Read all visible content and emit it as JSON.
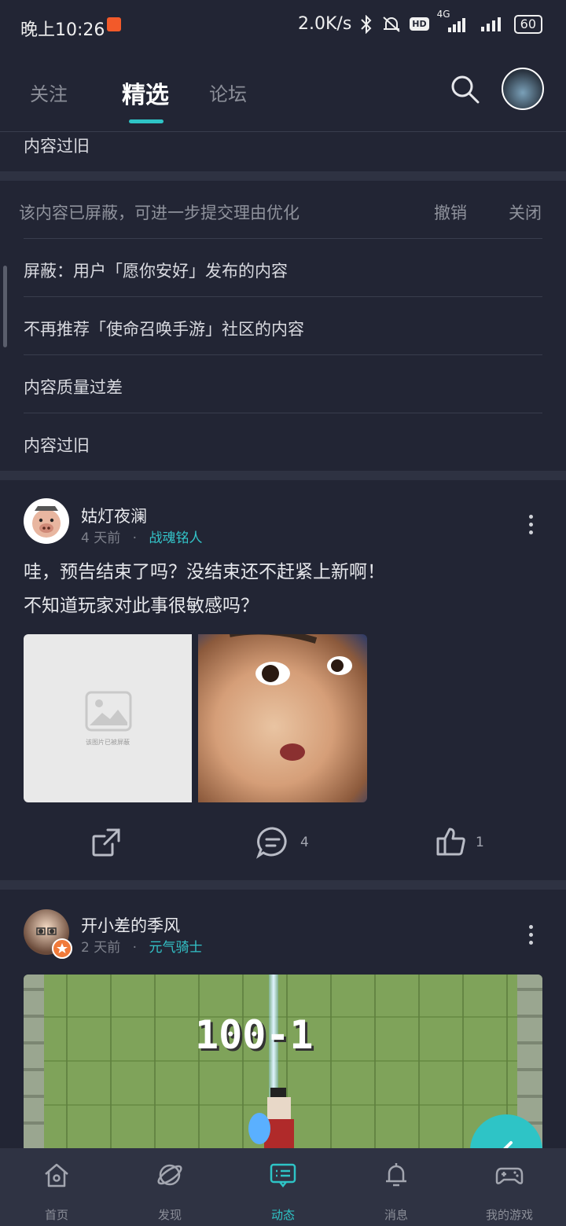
{
  "status_bar": {
    "time": "晚上10:26",
    "net_speed": "2.0K/s",
    "network": "4G",
    "hd": "HD",
    "battery": "60"
  },
  "top_tabs": [
    "关注",
    "精选",
    "论坛"
  ],
  "active_tab_index": 1,
  "colors": {
    "accent": "#2ec4c6",
    "background": "#222534",
    "nav": "#2f3343"
  },
  "prev_item": {
    "text": "内容过旧"
  },
  "block_panel": {
    "notice": "该内容已屏蔽，可进一步提交理由优化",
    "undo": "撤销",
    "close": "关闭",
    "reasons": [
      "屏蔽：用户「愿你安好」发布的内容",
      "不再推荐「使命召唤手游」社区的内容",
      "内容质量过差",
      "内容过旧"
    ]
  },
  "posts": [
    {
      "author": "姑灯夜澜",
      "time": "4 天前",
      "separator": "·",
      "game": "战魂铭人",
      "lines": [
        "哇，预告结束了吗？没结束还不赶紧上新啊！",
        "不知道玩家对此事很敏感吗？"
      ],
      "blocked_image_text": "该图片已被屏蔽",
      "comments": "4",
      "likes": "1"
    },
    {
      "author": "开小差的季风",
      "time": "2 天前",
      "separator": "·",
      "game": "元气骑士",
      "image_text": "100-1"
    }
  ],
  "bottom_nav": [
    {
      "label": "首页",
      "icon": "home-icon"
    },
    {
      "label": "发现",
      "icon": "planet-icon"
    },
    {
      "label": "动态",
      "icon": "feed-icon"
    },
    {
      "label": "消息",
      "icon": "bell-icon"
    },
    {
      "label": "我的游戏",
      "icon": "gamepad-icon"
    }
  ],
  "active_nav_index": 2
}
